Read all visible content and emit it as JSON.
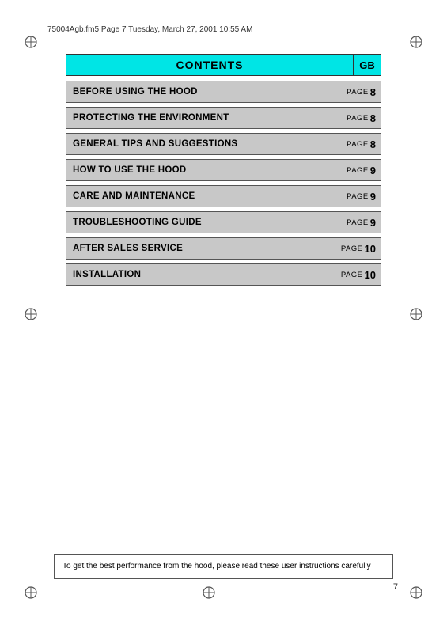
{
  "header": {
    "filename": "75004Agb.fm5  Page 7  Tuesday, March 27, 2001  10:55 AM"
  },
  "contents": {
    "title": "CONTENTS",
    "gb_label": "GB"
  },
  "toc_items": [
    {
      "label": "BEFORE USING THE HOOD",
      "page_word": "PAGE",
      "page_num": "8"
    },
    {
      "label": "PROTECTING THE ENVIRONMENT",
      "page_word": "PAGE",
      "page_num": "8"
    },
    {
      "label": "GENERAL TIPS AND SUGGESTIONS",
      "page_word": "PAGE",
      "page_num": "8"
    },
    {
      "label": "HOW TO USE THE HOOD",
      "page_word": "PAGE",
      "page_num": "9"
    },
    {
      "label": "CARE AND MAINTENANCE",
      "page_word": "PAGE",
      "page_num": "9"
    },
    {
      "label": "TROUBLESHOOTING GUIDE",
      "page_word": "PAGE",
      "page_num": "9"
    },
    {
      "label": "AFTER SALES SERVICE",
      "page_word": "PAGE",
      "page_num": "10"
    },
    {
      "label": "INSTALLATION",
      "page_word": "PAGE",
      "page_num": "10"
    }
  ],
  "footer": {
    "note": "To get the best performance from the hood, please read these user instructions carefully"
  },
  "page_number": "7"
}
